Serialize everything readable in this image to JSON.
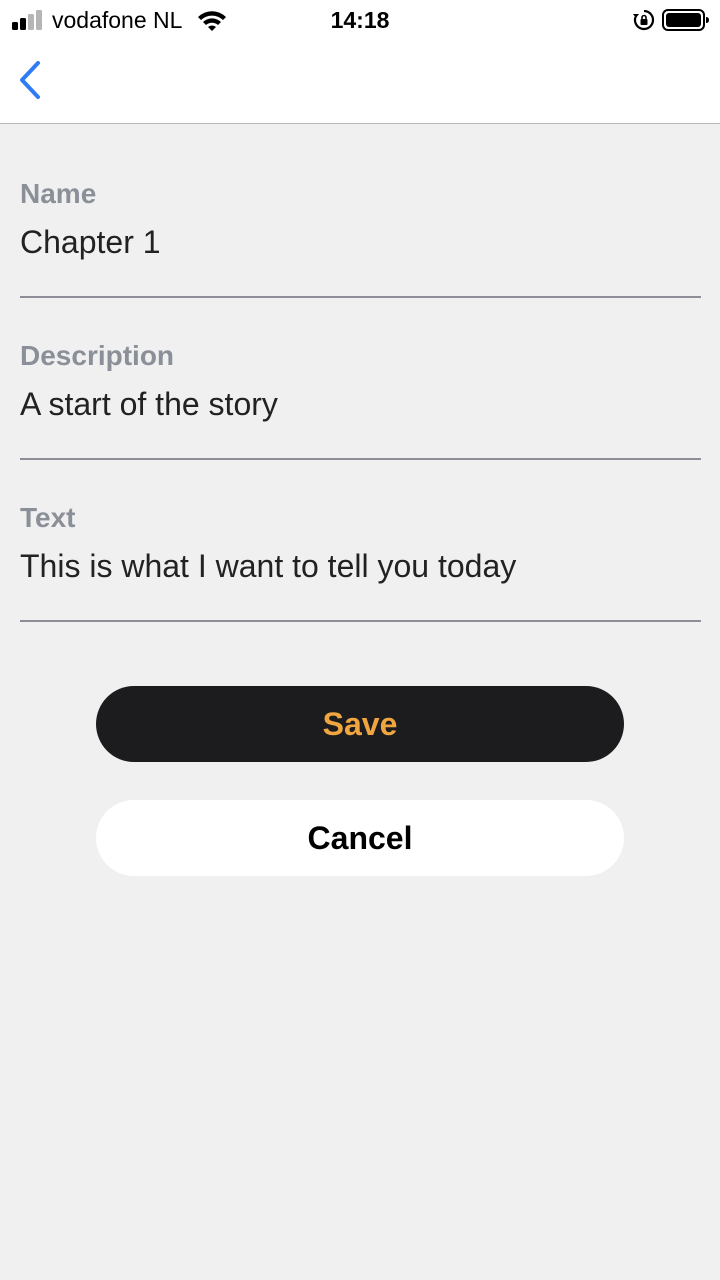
{
  "status_bar": {
    "carrier": "vodafone NL",
    "time": "14:18",
    "signal_bars_filled": 2,
    "signal_bars_total": 4,
    "battery_level": 1.0,
    "icons": [
      "signal-icon",
      "wifi-icon",
      "orientation-lock-icon",
      "battery-icon"
    ]
  },
  "nav": {
    "back_icon": "chevron-left-icon",
    "accent_color": "#2f7cf6"
  },
  "form": {
    "fields": [
      {
        "label": "Name",
        "value": "Chapter 1"
      },
      {
        "label": "Description",
        "value": "A start of the story"
      },
      {
        "label": "Text",
        "value": "This is what I want to tell you today"
      }
    ]
  },
  "actions": {
    "save_label": "Save",
    "cancel_label": "Cancel",
    "save_text_color": "#f0a640",
    "save_bg_color": "#1c1c1e"
  }
}
